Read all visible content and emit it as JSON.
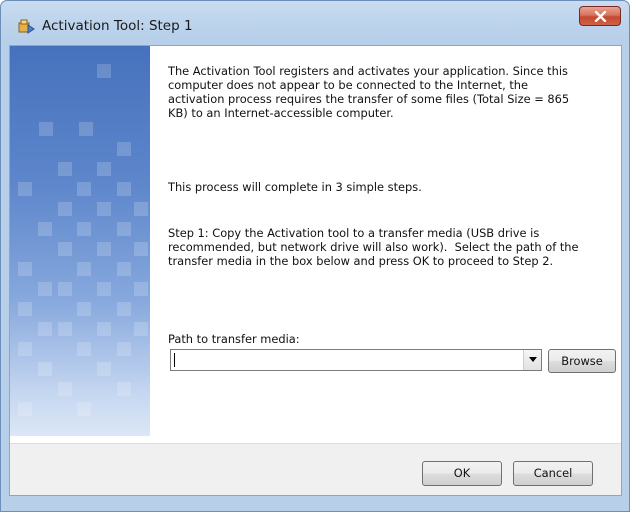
{
  "window": {
    "title": "Activation Tool: Step 1",
    "title_icon": "activation-tool-icon",
    "close_icon": "close-x-icon"
  },
  "content": {
    "paragraph1": "The Activation Tool registers and activates your application. Since this\ncomputer does not appear to be connected to the Internet, the\nactivation process requires the transfer of some files (Total Size = 865\nKB) to an Internet-accessible computer.",
    "paragraph2": "This process will complete in 3 simple steps.",
    "paragraph3": "Step 1: Copy the Activation tool to a transfer media (USB drive is\nrecommended, but network drive will also work).  Select the path of the\ntransfer media in the box below and press OK to proceed to Step 2.",
    "path_label": "Path to transfer media:",
    "path_value": "",
    "browse_label": "Browse"
  },
  "buttons": {
    "ok": "OK",
    "cancel": "Cancel"
  },
  "colors": {
    "banner_top": "#4672bd",
    "banner_bottom": "#dce7f6",
    "close_red": "#c4482e"
  }
}
